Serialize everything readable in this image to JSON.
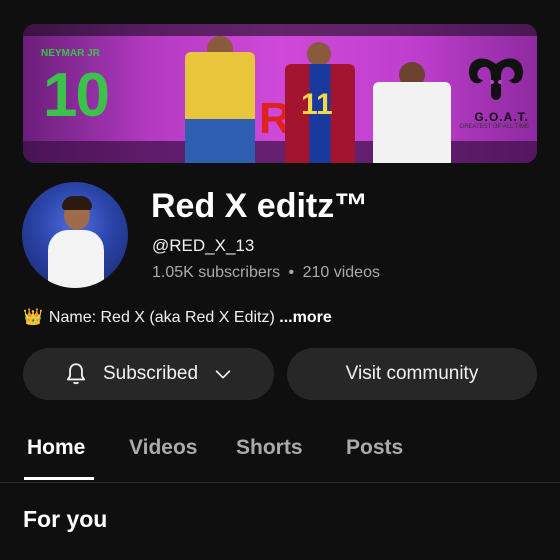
{
  "banner": {
    "number": "10",
    "small_text": "NEYMAR JR",
    "player_number": "11",
    "center_mark": "RED X",
    "goat_title": "G.O.A.T.",
    "goat_subtitle": "GREATEST OF ALL TIME"
  },
  "channel": {
    "name": "Red X editz™",
    "handle": "@RED_X_13",
    "subscribers": "1.05K subscribers",
    "separator": "•",
    "videos": "210 videos"
  },
  "description": {
    "text": "Name: Red X (aka Red X Editz)",
    "more_label": "...more"
  },
  "buttons": {
    "subscribed_label": "Subscribed",
    "visit_community_label": "Visit community"
  },
  "tabs": [
    {
      "label": "Home"
    },
    {
      "label": "Videos"
    },
    {
      "label": "Shorts"
    },
    {
      "label": "Posts"
    }
  ],
  "section": {
    "title": "For you"
  },
  "colors": {
    "background": "#0f0f0f",
    "button_bg": "#272727",
    "muted_text": "#aaaaaa",
    "banner_accent": "#c03fcf"
  }
}
